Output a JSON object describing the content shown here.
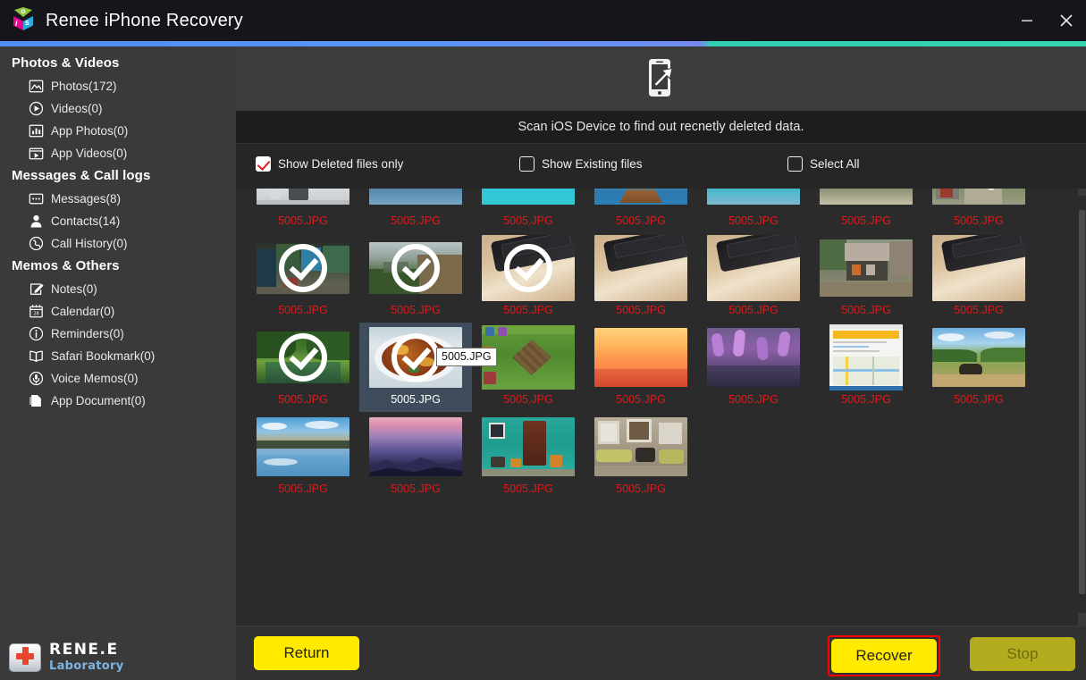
{
  "window": {
    "title": "Renee iPhone Recovery",
    "app_icon": "renee-cube-icon",
    "cube_glyph_top": "o",
    "cube_glyph_left": "i",
    "cube_glyph_right": "s",
    "minimize_label": "Minimize",
    "close_label": "Close",
    "accent_color_left": "#4f8ff7",
    "accent_color_right": "#2fcfb3"
  },
  "sidebar": {
    "groups": [
      {
        "title": "Photos & Videos",
        "items": [
          {
            "label": "Photos(172)",
            "icon": "photo-icon"
          },
          {
            "label": "Videos(0)",
            "icon": "play-circle-icon"
          },
          {
            "label": "App Photos(0)",
            "icon": "bar-chart-icon"
          },
          {
            "label": "App Videos(0)",
            "icon": "app-video-icon"
          }
        ]
      },
      {
        "title": "Messages & Call logs",
        "items": [
          {
            "label": "Messages(8)",
            "icon": "message-icon"
          },
          {
            "label": "Contacts(14)",
            "icon": "person-icon"
          },
          {
            "label": "Call History(0)",
            "icon": "phone-circle-icon"
          }
        ]
      },
      {
        "title": "Memos & Others",
        "items": [
          {
            "label": "Notes(0)",
            "icon": "note-pencil-icon"
          },
          {
            "label": "Calendar(0)",
            "icon": "calendar-icon"
          },
          {
            "label": "Reminders(0)",
            "icon": "info-circle-icon"
          },
          {
            "label": "Safari Bookmark(0)",
            "icon": "book-icon"
          },
          {
            "label": "Voice Memos(0)",
            "icon": "microphone-circle-icon"
          },
          {
            "label": "App Document(0)",
            "icon": "document-icon"
          }
        ]
      }
    ],
    "footer_logo": {
      "icon": "renee-keyboard-cross-icon",
      "name": "RENE.E",
      "subtitle": "Laboratory",
      "subtitle_color": "#7fb4e0"
    }
  },
  "main": {
    "banner_icon": "phone-scan-icon",
    "scan_caption": "Scan iOS Device to find out recnetly deleted data.",
    "filters": [
      {
        "label": "Show Deleted files only",
        "checked": true,
        "check_color": "#e02020"
      },
      {
        "label": "Show Existing files",
        "checked": false,
        "check_color": "#ffffff"
      },
      {
        "label": "Select All",
        "checked": false,
        "check_color": "#ffffff"
      }
    ],
    "tooltip": {
      "text": "5005.JPG",
      "visible": true
    },
    "file_label_color": "#e21818",
    "grid": {
      "columns": 7,
      "items": [
        {
          "label": "5005.JPG",
          "selected": false,
          "checked": false,
          "thumb": "kitchen-hood",
          "clipped_top": true
        },
        {
          "label": "5005.JPG",
          "selected": false,
          "checked": false,
          "thumb": "lake-clouds",
          "clipped_top": true
        },
        {
          "label": "5005.JPG",
          "selected": false,
          "checked": false,
          "thumb": "turquoise-lake",
          "clipped_top": true
        },
        {
          "label": "5005.JPG",
          "selected": false,
          "checked": false,
          "thumb": "pier-sunset",
          "clipped_top": true
        },
        {
          "label": "5005.JPG",
          "selected": false,
          "checked": false,
          "thumb": "blue-green-reef",
          "clipped_top": true
        },
        {
          "label": "5005.JPG",
          "selected": false,
          "checked": false,
          "thumb": "green-forest",
          "clipped_top": true
        },
        {
          "label": "5005.JPG",
          "selected": false,
          "checked": false,
          "thumb": "red-gate-path",
          "clipped_top": true
        },
        {
          "label": "5005.JPG",
          "selected": false,
          "checked": true,
          "thumb": "alley-street",
          "clipped_top": false
        },
        {
          "label": "5005.JPG",
          "selected": false,
          "checked": true,
          "thumb": "misty-hill",
          "clipped_top": false
        },
        {
          "label": "5005.JPG",
          "selected": false,
          "checked": true,
          "thumb": "keyboard-desk",
          "clipped_top": false
        },
        {
          "label": "5005.JPG",
          "selected": false,
          "checked": false,
          "thumb": "keyboard-desk",
          "clipped_top": false
        },
        {
          "label": "5005.JPG",
          "selected": false,
          "checked": false,
          "thumb": "keyboard-desk",
          "clipped_top": false
        },
        {
          "label": "5005.JPG",
          "selected": false,
          "checked": false,
          "thumb": "old-town-alley",
          "clipped_top": false
        },
        {
          "label": "5005.JPG",
          "selected": false,
          "checked": false,
          "thumb": "keyboard-desk",
          "clipped_top": false
        },
        {
          "label": "5005.JPG",
          "selected": false,
          "checked": true,
          "thumb": "green-pond",
          "clipped_top": false
        },
        {
          "label": "5005.JPG",
          "selected": true,
          "checked": true,
          "thumb": "food-plate",
          "clipped_top": false
        },
        {
          "label": "5005.JPG",
          "selected": false,
          "checked": false,
          "thumb": "game-village",
          "clipped_top": false
        },
        {
          "label": "5005.JPG",
          "selected": false,
          "checked": false,
          "thumb": "orange-sunset",
          "clipped_top": false
        },
        {
          "label": "5005.JPG",
          "selected": false,
          "checked": false,
          "thumb": "lavender",
          "clipped_top": false
        },
        {
          "label": "5005.JPG",
          "selected": false,
          "checked": false,
          "thumb": "map-page",
          "clipped_top": false
        },
        {
          "label": "5005.JPG",
          "selected": false,
          "checked": false,
          "thumb": "meadow-cow",
          "clipped_top": false
        },
        {
          "label": "5005.JPG",
          "selected": false,
          "checked": false,
          "thumb": "salt-lake",
          "clipped_top": false
        },
        {
          "label": "5005.JPG",
          "selected": false,
          "checked": false,
          "thumb": "purple-dusk",
          "clipped_top": false
        },
        {
          "label": "5005.JPG",
          "selected": false,
          "checked": false,
          "thumb": "teal-door",
          "clipped_top": false
        },
        {
          "label": "5005.JPG",
          "selected": false,
          "checked": false,
          "thumb": "stone-window",
          "clipped_top": false
        }
      ]
    }
  },
  "footer": {
    "return_label": "Return",
    "recover_label": "Recover",
    "stop_label": "Stop",
    "recover_highlight_color": "#ff0000",
    "button_color": "#ffea00",
    "stop_disabled": true
  }
}
